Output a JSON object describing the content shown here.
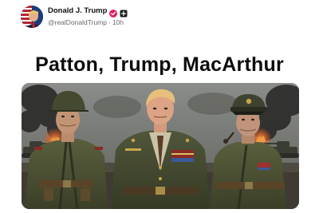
{
  "post": {
    "author": {
      "display_name": "Donald J. Trump",
      "handle": "@realDonaldTrump",
      "time_ago": "10h",
      "separator": "·",
      "verified_badge_icon": "verified-badge-icon",
      "add_icon": "plus-square-icon"
    },
    "headline": "Patton, Trump, MacArthur",
    "image": {
      "depicts": "three-military-officers-battlefield",
      "accent_colors": {
        "sky": "#7c7f7c",
        "smoke": "#2f2f2d",
        "fire": "#e07a2a",
        "uniform": "#4b5236"
      }
    }
  }
}
